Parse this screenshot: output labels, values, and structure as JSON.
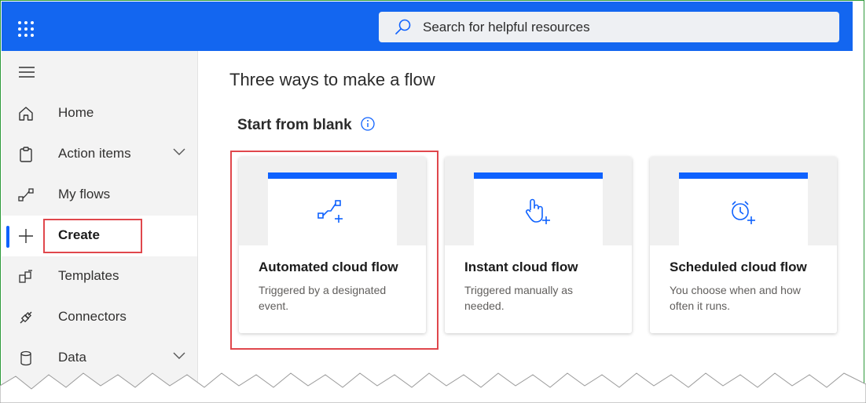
{
  "header": {
    "search_placeholder": "Search for helpful resources",
    "accent_color": "#1366f0"
  },
  "sidebar": {
    "items": [
      {
        "label": "Home",
        "icon": "home-icon"
      },
      {
        "label": "Action items",
        "icon": "clipboard-icon",
        "expandable": true
      },
      {
        "label": "My flows",
        "icon": "flow-icon"
      },
      {
        "label": "Create",
        "icon": "plus-icon",
        "active": true
      },
      {
        "label": "Templates",
        "icon": "templates-icon"
      },
      {
        "label": "Connectors",
        "icon": "connector-icon"
      },
      {
        "label": "Data",
        "icon": "database-icon",
        "expandable": true
      }
    ]
  },
  "main": {
    "title": "Three ways to make a flow",
    "section_title": "Start from blank",
    "cards": [
      {
        "title": "Automated cloud flow",
        "description": "Triggered by a designated event.",
        "icon": "automated-flow-icon",
        "highlighted": true
      },
      {
        "title": "Instant cloud flow",
        "description": "Triggered manually as needed.",
        "icon": "touch-icon"
      },
      {
        "title": "Scheduled cloud flow",
        "description": "You choose when and how often it runs.",
        "icon": "alarm-clock-icon"
      }
    ]
  },
  "annotation_color": "#e0474c"
}
